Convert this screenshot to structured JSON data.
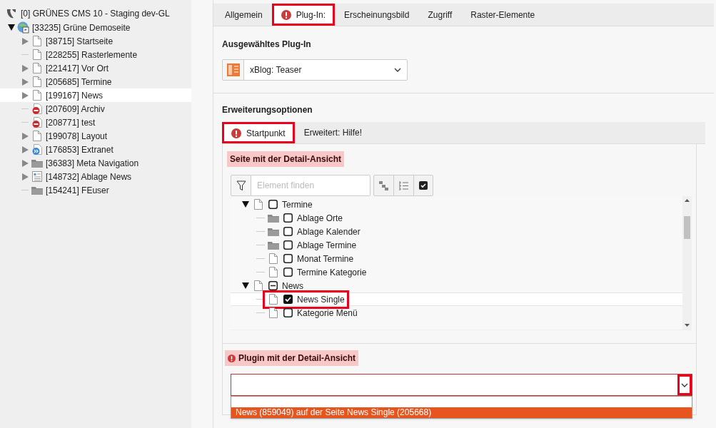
{
  "page_tree": {
    "root": {
      "label": "[0] GRÜNES CMS 10 - Staging dev-GL"
    },
    "items": [
      {
        "label": "[33235] Grüne Demoseite",
        "kind": "site",
        "expanded": true,
        "selected": false,
        "children": [
          {
            "label": "[38715] Startseite",
            "kind": "page",
            "expanded": false,
            "selected": false
          },
          {
            "label": "[228255] Rasterlemente",
            "kind": "page",
            "selected": false
          },
          {
            "label": "[221417] Vor Ort",
            "kind": "page",
            "expanded": false,
            "selected": false
          },
          {
            "label": "[205685] Termine",
            "kind": "page",
            "expanded": false,
            "selected": false
          },
          {
            "label": "[199167] News",
            "kind": "page",
            "expanded": false,
            "selected": true
          },
          {
            "label": "[207609] Archiv",
            "kind": "hidden",
            "selected": false
          },
          {
            "label": "[208771] test",
            "kind": "hidden",
            "selected": false
          },
          {
            "label": "[199078] Layout",
            "kind": "page",
            "expanded": false,
            "selected": false
          },
          {
            "label": "[176853] Extranet",
            "kind": "shortcut",
            "expanded": false,
            "selected": false
          },
          {
            "label": "[36383] Meta Navigation",
            "kind": "folder",
            "expanded": false,
            "selected": false
          },
          {
            "label": "[148732] Ablage News",
            "kind": "list",
            "expanded": false,
            "selected": false
          },
          {
            "label": "[154241] FEuser",
            "kind": "folder",
            "selected": false
          }
        ]
      }
    ]
  },
  "tabs": [
    {
      "label": "Allgemein",
      "selected": false,
      "error": false,
      "highlighted": false
    },
    {
      "label": "Plug-In:",
      "selected": true,
      "error": true,
      "highlighted": true
    },
    {
      "label": "Erscheinungsbild",
      "selected": false,
      "error": false,
      "highlighted": false
    },
    {
      "label": "Zugriff",
      "selected": false,
      "error": false,
      "highlighted": false
    },
    {
      "label": "Raster-Elemente",
      "selected": false,
      "error": false,
      "highlighted": false
    }
  ],
  "plugin_section": {
    "heading": "Ausgewähltes Plug-In",
    "select_value": "xBlog: Teaser"
  },
  "extension_section": {
    "heading": "Erweiterungsoptionen",
    "tabs": [
      {
        "label": "Startpunkt",
        "selected": true,
        "error": true,
        "highlighted": true
      },
      {
        "label": "Erweitert: Hilfe!",
        "selected": false,
        "error": false,
        "highlighted": false
      }
    ],
    "detail_page": {
      "label": "Seite mit der Detail-Ansicht",
      "error": false,
      "search_placeholder": "Element finden",
      "tree": [
        {
          "label": "Termine",
          "kind": "page",
          "expanded": true,
          "checked": false,
          "partial": false,
          "selected": false,
          "highlighted": false,
          "children": [
            {
              "label": "Ablage Orte",
              "kind": "folder",
              "checked": false,
              "partial": false,
              "selected": false,
              "highlighted": false
            },
            {
              "label": "Ablage Kalender",
              "kind": "folder",
              "checked": false,
              "partial": false,
              "selected": false,
              "highlighted": false
            },
            {
              "label": "Ablage Termine",
              "kind": "folder",
              "checked": false,
              "partial": false,
              "selected": false,
              "highlighted": false
            },
            {
              "label": "Monat Termine",
              "kind": "page",
              "checked": false,
              "partial": false,
              "selected": false,
              "highlighted": false
            },
            {
              "label": "Termine Kategorie",
              "kind": "page",
              "checked": false,
              "partial": false,
              "selected": false,
              "highlighted": false
            }
          ]
        },
        {
          "label": "News",
          "kind": "page",
          "expanded": true,
          "checked": false,
          "partial": true,
          "selected": false,
          "highlighted": false,
          "children": [
            {
              "label": "News Single",
              "kind": "page",
              "checked": true,
              "selected": true,
              "highlighted": true
            },
            {
              "label": "Kategorie Menü",
              "kind": "page",
              "checked": false,
              "partial": false,
              "selected": false,
              "highlighted": false
            }
          ]
        }
      ]
    },
    "detail_plugin": {
      "label": "Plugin mit der Detail-Ansicht",
      "error": true,
      "caret_highlighted": true,
      "options": [
        {
          "selected": false
        },
        {
          "label": "News (859049) auf der Seite News Single (205668)",
          "selected": true
        }
      ]
    }
  }
}
